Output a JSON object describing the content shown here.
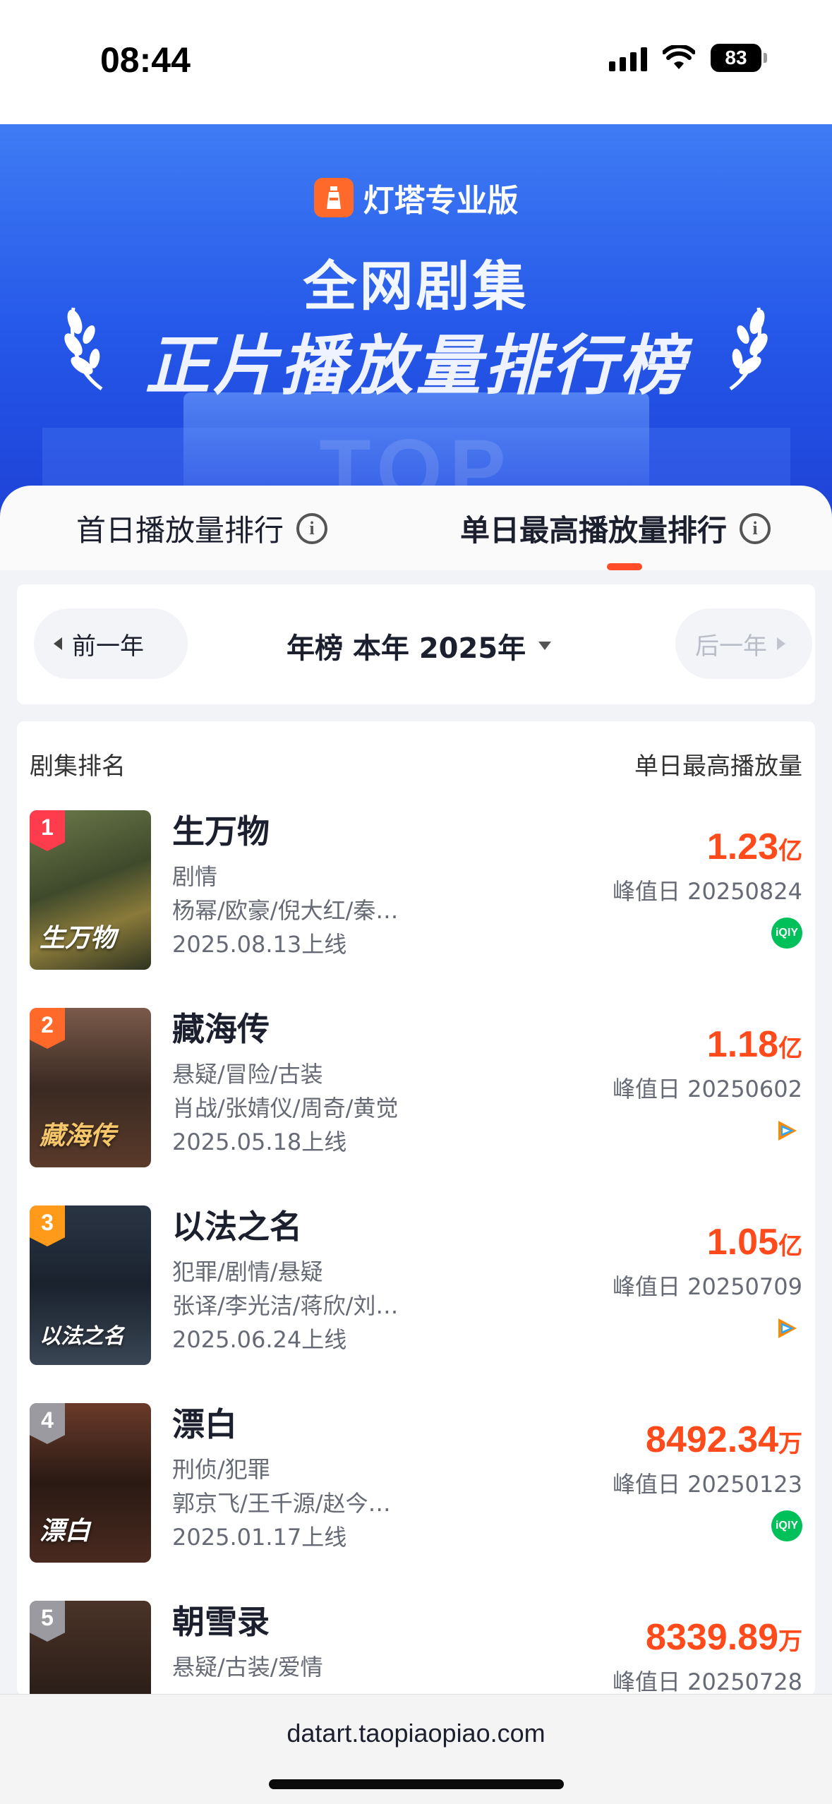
{
  "status_bar": {
    "time": "08:44",
    "battery": "83"
  },
  "banner": {
    "brand": "灯塔专业版",
    "title_line1": "全网剧集",
    "title_line2": "正片播放量排行榜",
    "background_word": "TOP"
  },
  "tabs": [
    {
      "label": "首日播放量排行",
      "active": false
    },
    {
      "label": "单日最高播放量排行",
      "active": true
    }
  ],
  "year_selector": {
    "prev_label": "前一年",
    "current_label": "年榜 本年 2025年",
    "next_label": "后一年"
  },
  "list": {
    "col_rank": "剧集排名",
    "col_value": "单日最高播放量",
    "items": [
      {
        "rank": "1",
        "title": "生万物",
        "genres": "剧情",
        "cast": "杨幂/欧豪/倪大红/秦…",
        "release": "2025.08.13上线",
        "value": "1.23",
        "unit": "亿",
        "peak": "峰值日 20250824",
        "platform": "iqiyi-icon",
        "poster_text": "生万物"
      },
      {
        "rank": "2",
        "title": "藏海传",
        "genres": "悬疑/冒险/古装",
        "cast": "肖战/张婧仪/周奇/黄觉",
        "release": "2025.05.18上线",
        "value": "1.18",
        "unit": "亿",
        "peak": "峰值日 20250602",
        "platform": "tencent-video-icon",
        "poster_text": "藏海传"
      },
      {
        "rank": "3",
        "title": "以法之名",
        "genres": "犯罪/剧情/悬疑",
        "cast": "张译/李光洁/蒋欣/刘…",
        "release": "2025.06.24上线",
        "value": "1.05",
        "unit": "亿",
        "peak": "峰值日 20250709",
        "platform": "tencent-video-icon",
        "poster_text": "以法之名"
      },
      {
        "rank": "4",
        "title": "漂白",
        "genres": "刑侦/犯罪",
        "cast": "郭京飞/王千源/赵今…",
        "release": "2025.01.17上线",
        "value": "8492.34",
        "unit": "万",
        "peak": "峰值日 20250123",
        "platform": "iqiyi-icon",
        "poster_text": "漂白"
      },
      {
        "rank": "5",
        "title": "朝雪录",
        "genres": "悬疑/古装/爱情",
        "cast": "",
        "release": "",
        "value": "8339.89",
        "unit": "万",
        "peak": "峰值日 20250728",
        "platform": "",
        "poster_text": ""
      }
    ]
  },
  "bottom_bar": {
    "url": "datart.taopiaopiao.com"
  },
  "colors": {
    "accent": "#ff4a1c",
    "banner_blue": "#2456e8",
    "brand_orange": "#ff6a2a"
  }
}
